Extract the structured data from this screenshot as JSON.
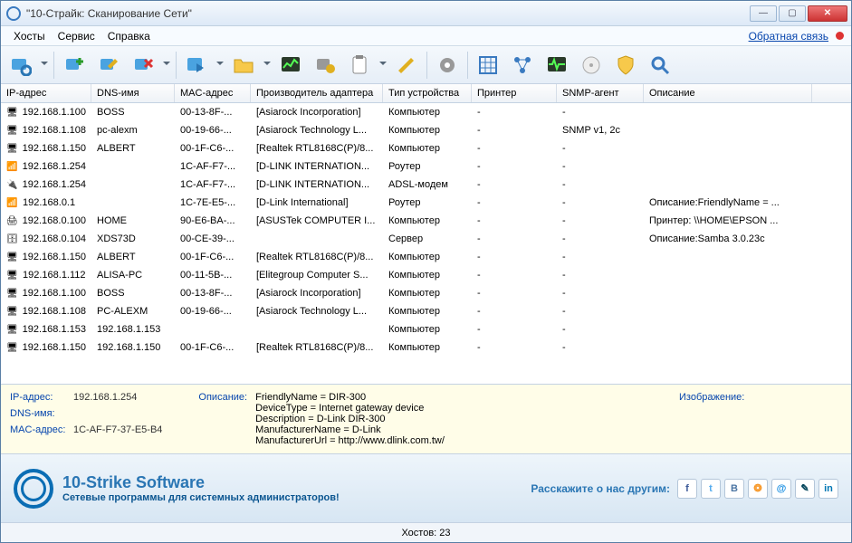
{
  "title": "\"10-Страйк: Сканирование Сети\"",
  "menu": {
    "hosts": "Хосты",
    "service": "Сервис",
    "help": "Справка",
    "feedback": "Обратная связь"
  },
  "toolbar_icons": [
    "scan",
    "add-host",
    "edit-host",
    "delete-host",
    "arrow",
    "folder",
    "chart",
    "settings-exe",
    "clipboard",
    "brush",
    "gear",
    "grid",
    "diagram",
    "pulse",
    "disc",
    "shield",
    "search"
  ],
  "columns": [
    "IP-адрес",
    "DNS-имя",
    "MAC-адрес",
    "Производитель адаптера",
    "Тип устройства",
    "Принтер",
    "SNMP-агент",
    "Описание"
  ],
  "rows": [
    {
      "icon": "pc",
      "ip": "192.168.1.100",
      "dns": "BOSS",
      "mac": "00-13-8F-...",
      "maker": "[Asiarock Incorporation]",
      "type": "Компьютер",
      "printer": "-",
      "snmp": "-",
      "desc": ""
    },
    {
      "icon": "pc",
      "ip": "192.168.1.108",
      "dns": "pc-alexm",
      "mac": "00-19-66-...",
      "maker": "[Asiarock Technology L...",
      "type": "Компьютер",
      "printer": "-",
      "snmp": "SNMP v1, 2c",
      "desc": ""
    },
    {
      "icon": "pc",
      "ip": "192.168.1.150",
      "dns": "ALBERT",
      "mac": "00-1F-C6-...",
      "maker": "[Realtek RTL8168C(P)/8...",
      "type": "Компьютер",
      "printer": "-",
      "snmp": "-",
      "desc": ""
    },
    {
      "icon": "router",
      "ip": "192.168.1.254",
      "dns": "",
      "mac": "1C-AF-F7-...",
      "maker": "[D-LINK INTERNATION...",
      "type": "Роутер",
      "printer": "-",
      "snmp": "-",
      "desc": ""
    },
    {
      "icon": "modem",
      "ip": "192.168.1.254",
      "dns": "",
      "mac": "1C-AF-F7-...",
      "maker": "[D-LINK INTERNATION...",
      "type": "ADSL-модем",
      "printer": "-",
      "snmp": "-",
      "desc": ""
    },
    {
      "icon": "router",
      "ip": "192.168.0.1",
      "dns": "",
      "mac": "1C-7E-E5-...",
      "maker": "[D-Link International]",
      "type": "Роутер",
      "printer": "-",
      "snmp": "-",
      "desc": "Описание:FriendlyName = ..."
    },
    {
      "icon": "printer",
      "ip": "192.168.0.100",
      "dns": "HOME",
      "mac": "90-E6-BA-...",
      "maker": "[ASUSTek COMPUTER I...",
      "type": "Компьютер",
      "printer": "-",
      "snmp": "-",
      "desc": "Принтер: \\\\HOME\\EPSON ..."
    },
    {
      "icon": "server",
      "ip": "192.168.0.104",
      "dns": "XDS73D",
      "mac": "00-CE-39-...",
      "maker": "",
      "type": "Сервер",
      "printer": "-",
      "snmp": "-",
      "desc": "Описание:Samba 3.0.23c"
    },
    {
      "icon": "pc",
      "ip": "192.168.1.150",
      "dns": "ALBERT",
      "mac": "00-1F-C6-...",
      "maker": "[Realtek RTL8168C(P)/8...",
      "type": "Компьютер",
      "printer": "-",
      "snmp": "-",
      "desc": ""
    },
    {
      "icon": "pc",
      "ip": "192.168.1.112",
      "dns": "ALISA-PC",
      "mac": "00-11-5B-...",
      "maker": "[Elitegroup Computer S...",
      "type": "Компьютер",
      "printer": "-",
      "snmp": "-",
      "desc": ""
    },
    {
      "icon": "pc",
      "ip": "192.168.1.100",
      "dns": "BOSS",
      "mac": "00-13-8F-...",
      "maker": "[Asiarock Incorporation]",
      "type": "Компьютер",
      "printer": "-",
      "snmp": "-",
      "desc": ""
    },
    {
      "icon": "pc",
      "ip": "192.168.1.108",
      "dns": "PC-ALEXM",
      "mac": "00-19-66-...",
      "maker": "[Asiarock Technology L...",
      "type": "Компьютер",
      "printer": "-",
      "snmp": "-",
      "desc": ""
    },
    {
      "icon": "pc",
      "ip": "192.168.1.153",
      "dns": "192.168.1.153",
      "mac": "",
      "maker": "",
      "type": "Компьютер",
      "printer": "-",
      "snmp": "-",
      "desc": ""
    },
    {
      "icon": "pc",
      "ip": "192.168.1.150",
      "dns": "192.168.1.150",
      "mac": "00-1F-C6-...",
      "maker": "[Realtek RTL8168C(P)/8...",
      "type": "Компьютер",
      "printer": "-",
      "snmp": "-",
      "desc": ""
    }
  ],
  "details": {
    "labels": {
      "ip": "IP-адрес:",
      "dns": "DNS-имя:",
      "mac": "MAC-адрес:",
      "desc": "Описание:",
      "img": "Изображение:"
    },
    "ip": "192.168.1.254",
    "dns": "",
    "mac": "1C-AF-F7-37-E5-B4",
    "desc_lines": [
      "FriendlyName = DIR-300",
      "DeviceType = Internet gateway device",
      "Description = D-Link DIR-300",
      "ManufacturerName = D-Link",
      "ManufacturerUrl = http://www.dlink.com.tw/"
    ]
  },
  "promo": {
    "brand": "10-Strike Software",
    "tagline": "Сетевые программы для системных администраторов!",
    "share_label": "Расскажите о нас другим:",
    "socials": [
      {
        "name": "facebook",
        "glyph": "f",
        "color": "#3b5998"
      },
      {
        "name": "twitter",
        "glyph": "t",
        "color": "#55acee"
      },
      {
        "name": "vk",
        "glyph": "В",
        "color": "#4c75a3"
      },
      {
        "name": "ok",
        "glyph": "❂",
        "color": "#f7931e"
      },
      {
        "name": "mail",
        "glyph": "@",
        "color": "#168de2"
      },
      {
        "name": "lj",
        "glyph": "✎",
        "color": "#004359"
      },
      {
        "name": "linkedin",
        "glyph": "in",
        "color": "#0077b5"
      }
    ]
  },
  "status": "Хостов: 23"
}
